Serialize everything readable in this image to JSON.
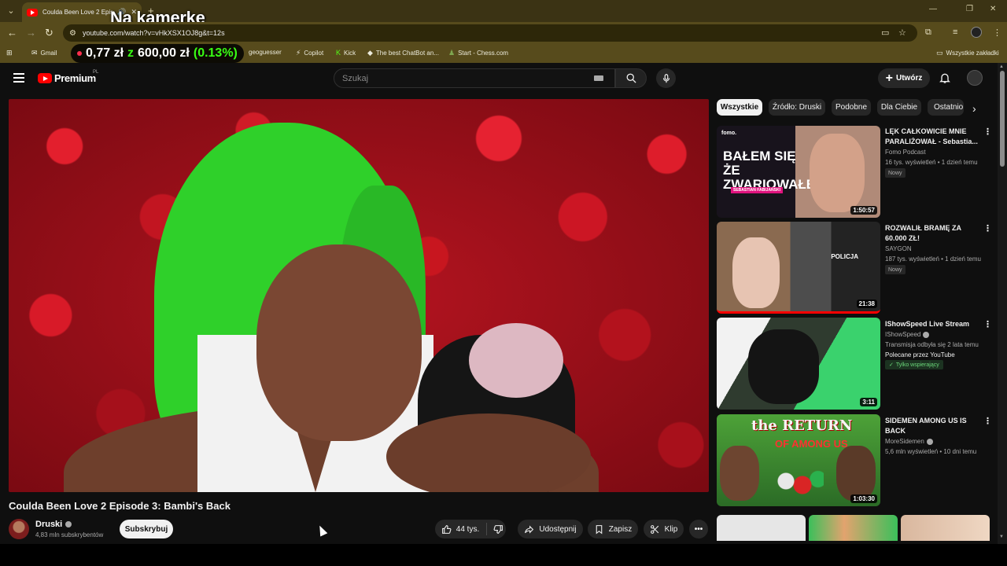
{
  "browser": {
    "tab_title": "Coulda Been Love 2 Episode",
    "url": "youtube.com/watch?v=vHkXSX1OJ8g&t=12s",
    "bookmarks": [
      {
        "label": "Gmail"
      },
      {
        "label": "geoguesser"
      },
      {
        "label": "Copilot"
      },
      {
        "label": "Kick"
      },
      {
        "label": "The best ChatBot an..."
      },
      {
        "label": "Start - Chess.com"
      }
    ],
    "all_bookmarks": "Wszystkie zakładki"
  },
  "overlay": {
    "stream_title": "Na kamerke",
    "ticker_value": "0,77 zł",
    "ticker_z": "z",
    "ticker_goal": "600,00 zł",
    "ticker_pct": "(0.13%)"
  },
  "header": {
    "logo_text": "Premium",
    "logo_country": "PL",
    "search_placeholder": "Szukaj",
    "create_label": "Utwórz"
  },
  "video": {
    "title": "Coulda Been Love 2 Episode 3: Bambi's Back",
    "channel": "Druski",
    "subscribers": "4,83 mln subskrybentów",
    "subscribe_label": "Subskrybuj",
    "likes": "44 tys.",
    "share_label": "Udostępnij",
    "save_label": "Zapisz",
    "clip_label": "Klip"
  },
  "chips": [
    "Wszystkie",
    "Źródło: Druski",
    "Podobne",
    "Dla Ciebie",
    "Ostatnio"
  ],
  "related": [
    {
      "title": "LĘK CAŁKOWICIE MNIE PARALIŻOWAŁ - Sebastia...",
      "channel": "Fomo Podcast",
      "meta": "16 tys. wyświetleń • 1 dzień temu",
      "badge": "Nowy",
      "duration": "1:50:57",
      "thumb_text": "BAŁEM SIĘ ŻE ZWARIOWAŁEM",
      "thumb_logo": "fomo.",
      "thumb_strap": "SEBASTIAN FABIJAŃSKI"
    },
    {
      "title": "ROZWALIŁ BRAMĘ ZA 60.000 ZŁ!",
      "channel": "SAYGON",
      "meta": "187 tys. wyświetleń • 1 dzień temu",
      "badge": "Nowy",
      "duration": "21:38",
      "thumb_text": "POLICJA"
    },
    {
      "title": "IShowSpeed Live Stream",
      "channel": "IShowSpeed",
      "meta": "Transmisja odbyła się 2 lata temu",
      "recommended": "Polecane przez YouTube",
      "member_badge": "Tylko wspierający",
      "duration": "3:11"
    },
    {
      "title": "SIDEMEN AMONG US IS BACK",
      "channel": "MoreSidemen",
      "meta": "5,6 mln wyświetleń • 10 dni temu",
      "duration": "1:03:30",
      "thumb_text_1": "the RETURN",
      "thumb_text_2": "OF AMONG US"
    }
  ],
  "colors": {
    "yt_red": "#ff0000",
    "browser_frame": "#574b1c",
    "ticker_green": "#39ff14"
  }
}
